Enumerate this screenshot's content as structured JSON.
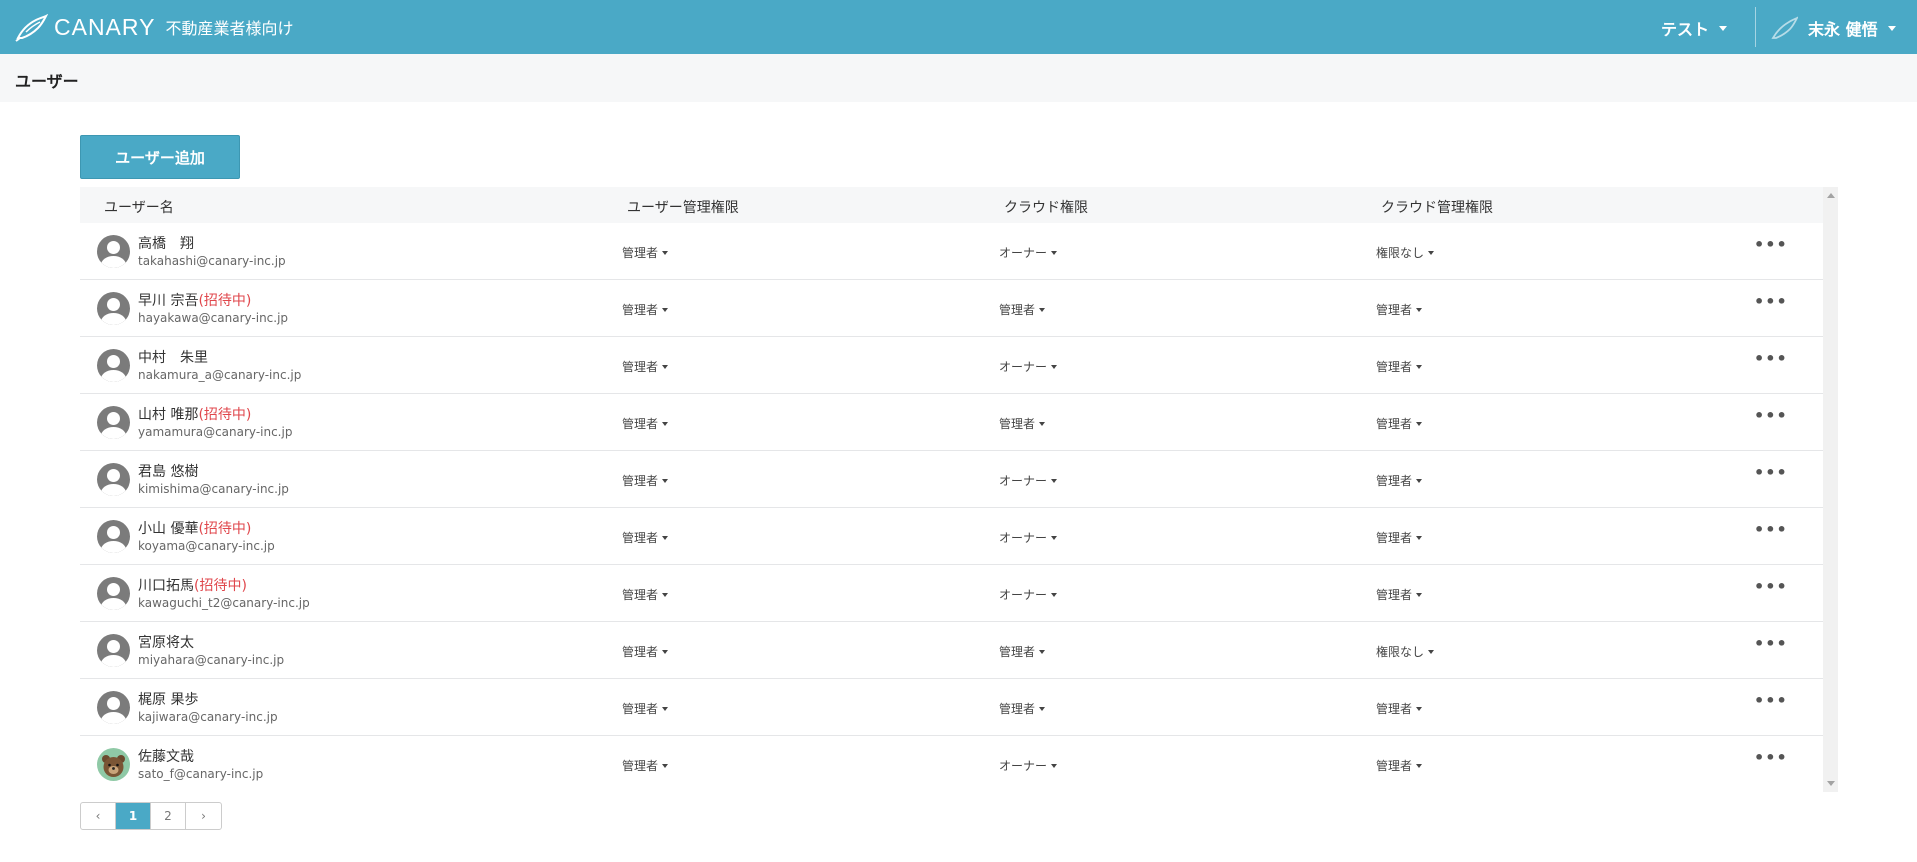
{
  "app": {
    "brand": "CANARY",
    "subtitle": "不動産業者様向け",
    "tenant": "テスト",
    "current_user": "末永 健悟",
    "page_title": "ユーザー"
  },
  "actions": {
    "add_user": "ユーザー追加"
  },
  "table": {
    "headers": [
      "ユーザー名",
      "ユーザー管理権限",
      "クラウド権限",
      "クラウド管理権限"
    ],
    "invite_label": "(招待中)",
    "more_label": "•••",
    "rows": [
      {
        "name": "高橋　翔",
        "invited": false,
        "email": "takahashi@canary-inc.jp",
        "user_perm": "管理者",
        "cloud_perm": "オーナー",
        "cloud_admin": "権限なし",
        "avatar": "default"
      },
      {
        "name": "早川 宗吾",
        "invited": true,
        "email": "hayakawa@canary-inc.jp",
        "user_perm": "管理者",
        "cloud_perm": "管理者",
        "cloud_admin": "管理者",
        "avatar": "default"
      },
      {
        "name": "中村　朱里",
        "invited": false,
        "email": "nakamura_a@canary-inc.jp",
        "user_perm": "管理者",
        "cloud_perm": "オーナー",
        "cloud_admin": "管理者",
        "avatar": "default"
      },
      {
        "name": "山村 唯那",
        "invited": true,
        "email": "yamamura@canary-inc.jp",
        "user_perm": "管理者",
        "cloud_perm": "管理者",
        "cloud_admin": "管理者",
        "avatar": "default"
      },
      {
        "name": "君島 悠樹",
        "invited": false,
        "email": "kimishima@canary-inc.jp",
        "user_perm": "管理者",
        "cloud_perm": "オーナー",
        "cloud_admin": "管理者",
        "avatar": "default"
      },
      {
        "name": "小山 優華",
        "invited": true,
        "email": "koyama@canary-inc.jp",
        "user_perm": "管理者",
        "cloud_perm": "オーナー",
        "cloud_admin": "管理者",
        "avatar": "default"
      },
      {
        "name": "川口拓馬",
        "invited": true,
        "email": "kawaguchi_t2@canary-inc.jp",
        "user_perm": "管理者",
        "cloud_perm": "オーナー",
        "cloud_admin": "管理者",
        "avatar": "default"
      },
      {
        "name": "宮原将太",
        "invited": false,
        "email": "miyahara@canary-inc.jp",
        "user_perm": "管理者",
        "cloud_perm": "管理者",
        "cloud_admin": "権限なし",
        "avatar": "default"
      },
      {
        "name": "梶原 果歩",
        "invited": false,
        "email": "kajiwara@canary-inc.jp",
        "user_perm": "管理者",
        "cloud_perm": "管理者",
        "cloud_admin": "管理者",
        "avatar": "default"
      },
      {
        "name": "佐藤文哉",
        "invited": false,
        "email": "sato_f@canary-inc.jp",
        "user_perm": "管理者",
        "cloud_perm": "オーナー",
        "cloud_admin": "管理者",
        "avatar": "bear"
      }
    ]
  },
  "pagination": {
    "prev": "‹",
    "pages": [
      "1",
      "2"
    ],
    "current": "1",
    "next": "›"
  },
  "colors": {
    "brand": "#4aa9c6",
    "invite": "#e0474c"
  }
}
